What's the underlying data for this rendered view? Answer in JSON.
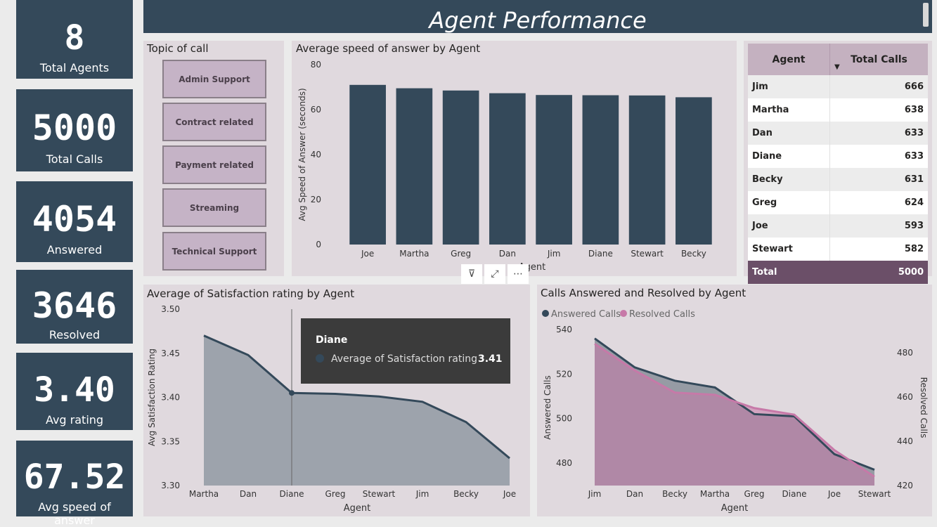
{
  "kpis": [
    {
      "value": "8",
      "label": "Total Agents"
    },
    {
      "value": "5000",
      "label": "Total Calls"
    },
    {
      "value": "4054",
      "label": "Answered"
    },
    {
      "value": "3646",
      "label": "Resolved"
    },
    {
      "value": "3.40",
      "label": "Avg rating"
    },
    {
      "value": "67.52",
      "label": "Avg speed of answer"
    }
  ],
  "title": "Agent Performance",
  "topic_slicer": {
    "title": "Topic of call",
    "items": [
      "Admin Support",
      "Contract related",
      "Payment related",
      "Streaming",
      "Technical Support"
    ]
  },
  "calls_table": {
    "headers": [
      "Agent",
      "Total Calls"
    ],
    "rows": [
      [
        "Jim",
        "666"
      ],
      [
        "Martha",
        "638"
      ],
      [
        "Dan",
        "633"
      ],
      [
        "Diane",
        "633"
      ],
      [
        "Becky",
        "631"
      ],
      [
        "Greg",
        "624"
      ],
      [
        "Joe",
        "593"
      ],
      [
        "Stewart",
        "582"
      ]
    ],
    "total": [
      "Total",
      "5000"
    ]
  },
  "tooltip": {
    "agent": "Diane",
    "measure": "Average of Satisfaction rating",
    "value": "3.41"
  },
  "chart_data": [
    {
      "type": "bar",
      "title": "Average speed of answer by Agent",
      "xlabel": "Agent",
      "ylabel": "Avg Speed of Answer (seconds)",
      "categories": [
        "Joe",
        "Martha",
        "Greg",
        "Dan",
        "Jim",
        "Diane",
        "Stewart",
        "Becky"
      ],
      "values": [
        71,
        69.5,
        68.5,
        67.3,
        66.5,
        66.4,
        66.3,
        65.5
      ],
      "ylim": [
        0,
        80
      ],
      "yticks": [
        0,
        20,
        40,
        60,
        80
      ]
    },
    {
      "type": "area",
      "title": "Average of Satisfaction rating by Agent",
      "xlabel": "Agent",
      "ylabel": "Avg Satisfaction Rating",
      "categories": [
        "Martha",
        "Dan",
        "Diane",
        "Greg",
        "Stewart",
        "Jim",
        "Becky",
        "Joe"
      ],
      "values": [
        3.47,
        3.448,
        3.405,
        3.404,
        3.401,
        3.395,
        3.372,
        3.331
      ],
      "ylim": [
        3.3,
        3.5
      ],
      "yticks": [
        "3.30",
        "3.35",
        "3.40",
        "3.45",
        "3.50"
      ]
    },
    {
      "type": "area",
      "title": "Calls Answered and Resolved by Agent",
      "xlabel": "Agent",
      "ylabel": "Answered Calls",
      "y2label": "Resolved Calls",
      "categories": [
        "Jim",
        "Dan",
        "Becky",
        "Martha",
        "Greg",
        "Diane",
        "Joe",
        "Stewart"
      ],
      "series": [
        {
          "name": "Answered Calls",
          "values": [
            536,
            523,
            517,
            514,
            502,
            501,
            484,
            477
          ],
          "color": "#34495a",
          "ylim": [
            470,
            542
          ],
          "yticks": [
            480,
            500,
            520,
            540
          ]
        },
        {
          "name": "Resolved Calls",
          "values": [
            484,
            472,
            462,
            461,
            455,
            452,
            436,
            424
          ],
          "color": "#c779a8",
          "ylim": [
            420,
            490
          ],
          "yticks": [
            420,
            440,
            460,
            480
          ]
        }
      ],
      "legend": "top-left"
    }
  ],
  "toolbar": {
    "filter": "⊽",
    "focus": "⤢",
    "more": "⋯"
  }
}
